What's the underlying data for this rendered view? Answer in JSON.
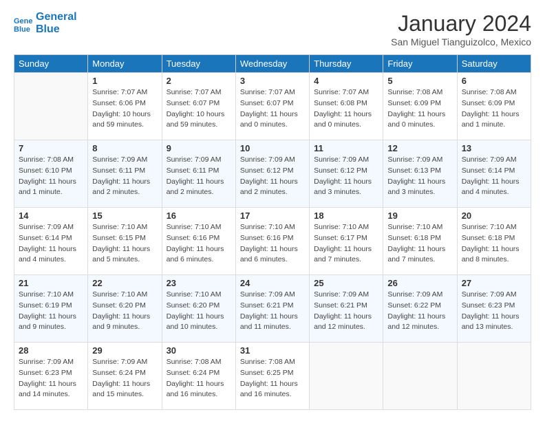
{
  "header": {
    "logo_line1": "General",
    "logo_line2": "Blue",
    "month": "January 2024",
    "location": "San Miguel Tianguizolco, Mexico"
  },
  "weekdays": [
    "Sunday",
    "Monday",
    "Tuesday",
    "Wednesday",
    "Thursday",
    "Friday",
    "Saturday"
  ],
  "weeks": [
    [
      {
        "day": "",
        "info": ""
      },
      {
        "day": "1",
        "info": "Sunrise: 7:07 AM\nSunset: 6:06 PM\nDaylight: 10 hours\nand 59 minutes."
      },
      {
        "day": "2",
        "info": "Sunrise: 7:07 AM\nSunset: 6:07 PM\nDaylight: 10 hours\nand 59 minutes."
      },
      {
        "day": "3",
        "info": "Sunrise: 7:07 AM\nSunset: 6:07 PM\nDaylight: 11 hours\nand 0 minutes."
      },
      {
        "day": "4",
        "info": "Sunrise: 7:07 AM\nSunset: 6:08 PM\nDaylight: 11 hours\nand 0 minutes."
      },
      {
        "day": "5",
        "info": "Sunrise: 7:08 AM\nSunset: 6:09 PM\nDaylight: 11 hours\nand 0 minutes."
      },
      {
        "day": "6",
        "info": "Sunrise: 7:08 AM\nSunset: 6:09 PM\nDaylight: 11 hours\nand 1 minute."
      }
    ],
    [
      {
        "day": "7",
        "info": "Sunrise: 7:08 AM\nSunset: 6:10 PM\nDaylight: 11 hours\nand 1 minute."
      },
      {
        "day": "8",
        "info": "Sunrise: 7:09 AM\nSunset: 6:11 PM\nDaylight: 11 hours\nand 2 minutes."
      },
      {
        "day": "9",
        "info": "Sunrise: 7:09 AM\nSunset: 6:11 PM\nDaylight: 11 hours\nand 2 minutes."
      },
      {
        "day": "10",
        "info": "Sunrise: 7:09 AM\nSunset: 6:12 PM\nDaylight: 11 hours\nand 2 minutes."
      },
      {
        "day": "11",
        "info": "Sunrise: 7:09 AM\nSunset: 6:12 PM\nDaylight: 11 hours\nand 3 minutes."
      },
      {
        "day": "12",
        "info": "Sunrise: 7:09 AM\nSunset: 6:13 PM\nDaylight: 11 hours\nand 3 minutes."
      },
      {
        "day": "13",
        "info": "Sunrise: 7:09 AM\nSunset: 6:14 PM\nDaylight: 11 hours\nand 4 minutes."
      }
    ],
    [
      {
        "day": "14",
        "info": "Sunrise: 7:09 AM\nSunset: 6:14 PM\nDaylight: 11 hours\nand 4 minutes."
      },
      {
        "day": "15",
        "info": "Sunrise: 7:10 AM\nSunset: 6:15 PM\nDaylight: 11 hours\nand 5 minutes."
      },
      {
        "day": "16",
        "info": "Sunrise: 7:10 AM\nSunset: 6:16 PM\nDaylight: 11 hours\nand 6 minutes."
      },
      {
        "day": "17",
        "info": "Sunrise: 7:10 AM\nSunset: 6:16 PM\nDaylight: 11 hours\nand 6 minutes."
      },
      {
        "day": "18",
        "info": "Sunrise: 7:10 AM\nSunset: 6:17 PM\nDaylight: 11 hours\nand 7 minutes."
      },
      {
        "day": "19",
        "info": "Sunrise: 7:10 AM\nSunset: 6:18 PM\nDaylight: 11 hours\nand 7 minutes."
      },
      {
        "day": "20",
        "info": "Sunrise: 7:10 AM\nSunset: 6:18 PM\nDaylight: 11 hours\nand 8 minutes."
      }
    ],
    [
      {
        "day": "21",
        "info": "Sunrise: 7:10 AM\nSunset: 6:19 PM\nDaylight: 11 hours\nand 9 minutes."
      },
      {
        "day": "22",
        "info": "Sunrise: 7:10 AM\nSunset: 6:20 PM\nDaylight: 11 hours\nand 9 minutes."
      },
      {
        "day": "23",
        "info": "Sunrise: 7:10 AM\nSunset: 6:20 PM\nDaylight: 11 hours\nand 10 minutes."
      },
      {
        "day": "24",
        "info": "Sunrise: 7:09 AM\nSunset: 6:21 PM\nDaylight: 11 hours\nand 11 minutes."
      },
      {
        "day": "25",
        "info": "Sunrise: 7:09 AM\nSunset: 6:21 PM\nDaylight: 11 hours\nand 12 minutes."
      },
      {
        "day": "26",
        "info": "Sunrise: 7:09 AM\nSunset: 6:22 PM\nDaylight: 11 hours\nand 12 minutes."
      },
      {
        "day": "27",
        "info": "Sunrise: 7:09 AM\nSunset: 6:23 PM\nDaylight: 11 hours\nand 13 minutes."
      }
    ],
    [
      {
        "day": "28",
        "info": "Sunrise: 7:09 AM\nSunset: 6:23 PM\nDaylight: 11 hours\nand 14 minutes."
      },
      {
        "day": "29",
        "info": "Sunrise: 7:09 AM\nSunset: 6:24 PM\nDaylight: 11 hours\nand 15 minutes."
      },
      {
        "day": "30",
        "info": "Sunrise: 7:08 AM\nSunset: 6:24 PM\nDaylight: 11 hours\nand 16 minutes."
      },
      {
        "day": "31",
        "info": "Sunrise: 7:08 AM\nSunset: 6:25 PM\nDaylight: 11 hours\nand 16 minutes."
      },
      {
        "day": "",
        "info": ""
      },
      {
        "day": "",
        "info": ""
      },
      {
        "day": "",
        "info": ""
      }
    ]
  ]
}
